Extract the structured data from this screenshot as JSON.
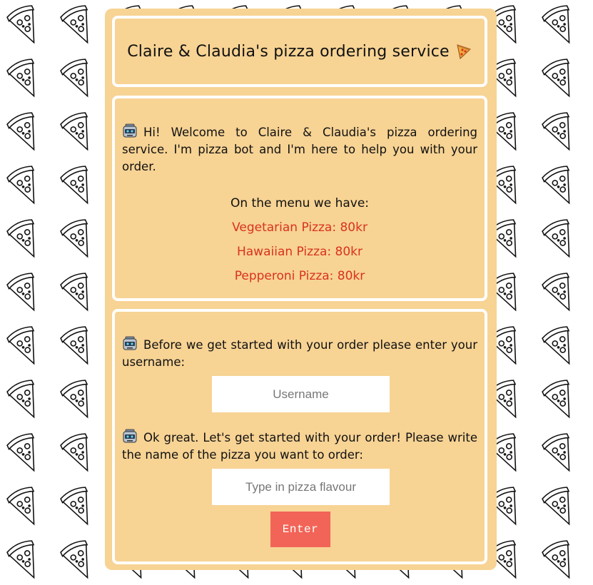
{
  "page": {
    "background_pattern": "pizza-slice-icon"
  },
  "header": {
    "title": "Claire & Claudia's pizza ordering service",
    "icon": "pizza-slice-icon"
  },
  "welcome": {
    "bot_icon": "robot-icon",
    "message": "Hi! Welcome to Claire & Claudia's pizza ordering service. I'm pizza bot and I'm here to help you with your order.",
    "menu_title": "On the menu we have:",
    "menu_items": [
      {
        "label": "Vegetarian Pizza: 80kr"
      },
      {
        "label": "Hawaiian Pizza: 80kr"
      },
      {
        "label": "Pepperoni Pizza: 80kr"
      }
    ]
  },
  "order": {
    "username_prompt": "Before we get started with your order please enter your username:",
    "username_placeholder": "Username",
    "username_value": "",
    "pizza_prompt": "Ok great. Let's get started with your order! Please write the name of the pizza you want to order:",
    "pizza_placeholder": "Type in pizza flavour",
    "pizza_value": "",
    "enter_label": "Enter"
  },
  "colors": {
    "panel_background": "#f7d394",
    "panel_border": "#ffffff",
    "menu_item_text": "#d9331e",
    "enter_button": "#f26457"
  }
}
